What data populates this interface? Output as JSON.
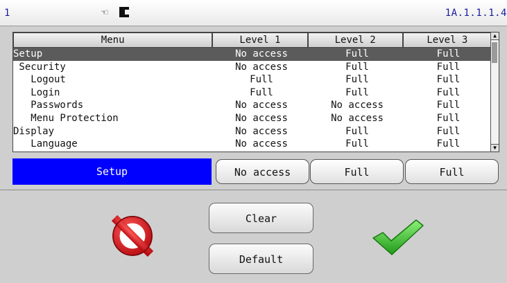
{
  "status_bar": {
    "channel": "1",
    "hand_glyph": "☜",
    "device_id": "1A.1.1.1.4"
  },
  "table": {
    "headers": [
      "Menu",
      "Level 1",
      "Level 2",
      "Level 3"
    ],
    "rows": [
      {
        "name": "Setup",
        "l1": "No access",
        "l2": "Full",
        "l3": "Full",
        "selected": true
      },
      {
        "name": " Security",
        "l1": "No access",
        "l2": "Full",
        "l3": "Full"
      },
      {
        "name": "   Logout",
        "l1": "Full",
        "l2": "Full",
        "l3": "Full"
      },
      {
        "name": "   Login",
        "l1": "Full",
        "l2": "Full",
        "l3": "Full"
      },
      {
        "name": "   Passwords",
        "l1": "No access",
        "l2": "No access",
        "l3": "Full"
      },
      {
        "name": "   Menu Protection",
        "l1": "No access",
        "l2": "No access",
        "l3": "Full"
      },
      {
        "name": "Display",
        "l1": "No access",
        "l2": "Full",
        "l3": "Full"
      },
      {
        "name": "   Language",
        "l1": "No access",
        "l2": "Full",
        "l3": "Full"
      }
    ]
  },
  "editor": {
    "name": "Setup",
    "level1": "No access",
    "level2": "Full",
    "level3": "Full"
  },
  "actions": {
    "clear_label": "Clear",
    "default_label": "Default"
  },
  "icons": {
    "cancel": "no-entry-icon",
    "ok": "checkmark-icon"
  },
  "colors": {
    "selected_row": "#5b5b5b",
    "edit_highlight": "#0000ff",
    "ok_green": "#3bb52f",
    "cancel_red": "#d9141b"
  }
}
